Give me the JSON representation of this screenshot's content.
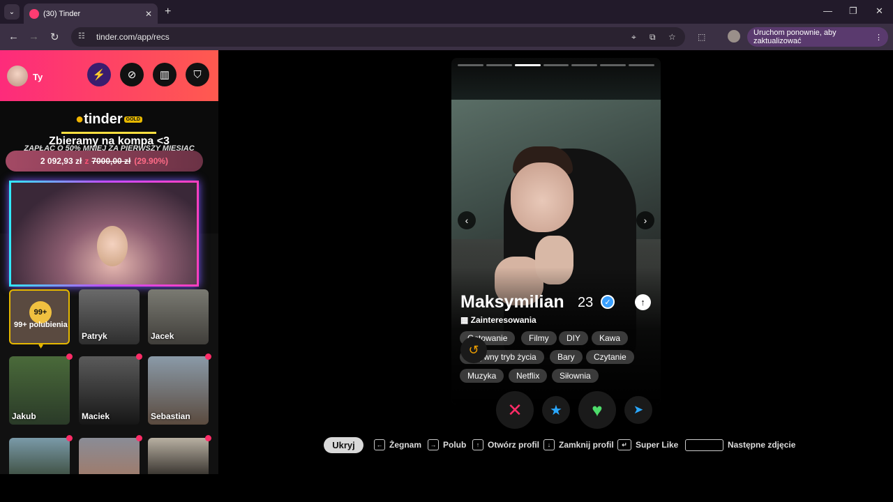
{
  "browser": {
    "tab_title": "(30) Tinder",
    "url": "tinder.com/app/recs",
    "update_label": "Uruchom ponownie, aby zaktualizować"
  },
  "sidebar": {
    "user_name": "Ty",
    "brand": "tinder",
    "brand_badge": "GOLD",
    "promo_title": "Zbieramy na kompa <3",
    "promo_subtitle": "ZAPŁAĆ O 50% MNIEJ ZA PIERWSZY MIESIĄC",
    "goal_current": "2 092,93 zł",
    "goal_of": "z",
    "goal_total": "7000,00 zł",
    "goal_percent": "(29.90%)",
    "likes_count": "99+",
    "likes_label": "99+ polubienia",
    "matches": [
      {
        "name": "Patryk"
      },
      {
        "name": "Jacek"
      },
      {
        "name": "Jakub"
      },
      {
        "name": "Maciek"
      },
      {
        "name": "Sebastian"
      },
      {
        "name": ""
      },
      {
        "name": ""
      },
      {
        "name": ""
      }
    ]
  },
  "profile": {
    "name": "Maksymilian",
    "age": "23",
    "interests_label": "Zainteresowania",
    "photo_index": 3,
    "photo_count": 7,
    "interests": [
      "Gotowanie",
      "Filmy",
      "DIY",
      "Kawa",
      "Aktywny tryb życia",
      "Bary",
      "Czytanie",
      "Muzyka",
      "Netflix",
      "Siłownia"
    ]
  },
  "shortcuts": {
    "hide": "Ukryj",
    "nope": "Żegnam",
    "like": "Polub",
    "open": "Otwórz profil",
    "close": "Zamknij profil",
    "superlike": "Super Like",
    "next_photo": "Następne zdjęcie"
  },
  "colors": {
    "brand": "#fe3c72",
    "gold": "#e6b800"
  }
}
